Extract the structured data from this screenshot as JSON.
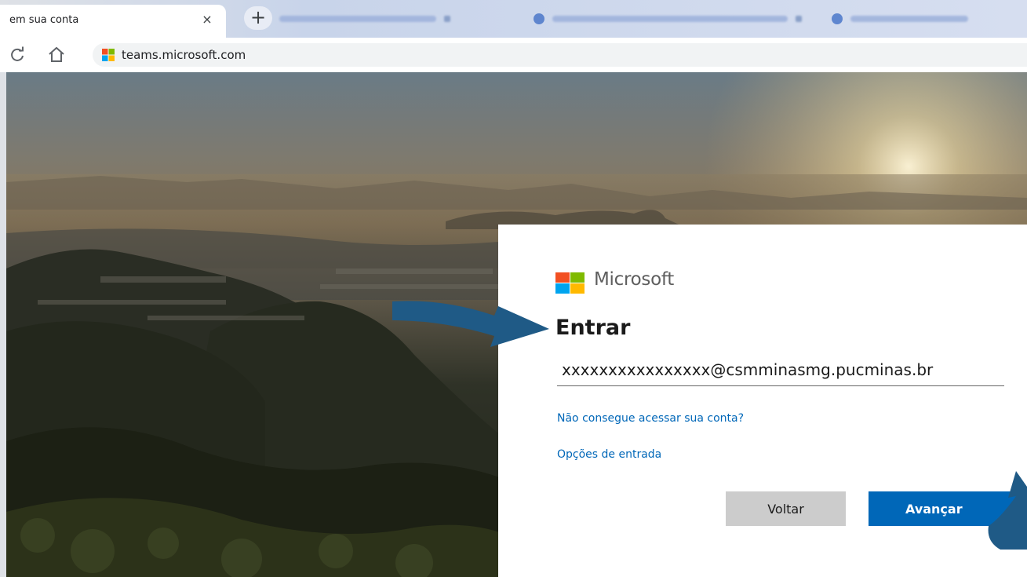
{
  "browser": {
    "active_tab": {
      "title": "em sua conta",
      "close": "×"
    },
    "new_tab_label": "+",
    "background_tabs": [
      {
        "icon": "page-favicon-icon"
      },
      {
        "icon": "globe-icon"
      },
      {
        "icon": "globe-icon"
      }
    ],
    "toolbar": {
      "reload_icon": "reload-icon",
      "home_icon": "home-icon",
      "url": "teams.microsoft.com"
    }
  },
  "signin": {
    "brand": "Microsoft",
    "title": "Entrar",
    "email_value": "xxxxxxxxxxxxxxxx@csmminasmg.pucminas.br",
    "cant_access_link": "Não consegue acessar sua conta?",
    "signin_options_link": "Opções de entrada",
    "back_button": "Voltar",
    "next_button": "Avançar"
  },
  "colors": {
    "ms_red": "#f25022",
    "ms_green": "#7fba00",
    "ms_blue": "#00a4ef",
    "ms_yellow": "#ffb900",
    "link": "#0067b8",
    "primary_button": "#0067b8",
    "annotation_arrow": "#1f5a86"
  }
}
